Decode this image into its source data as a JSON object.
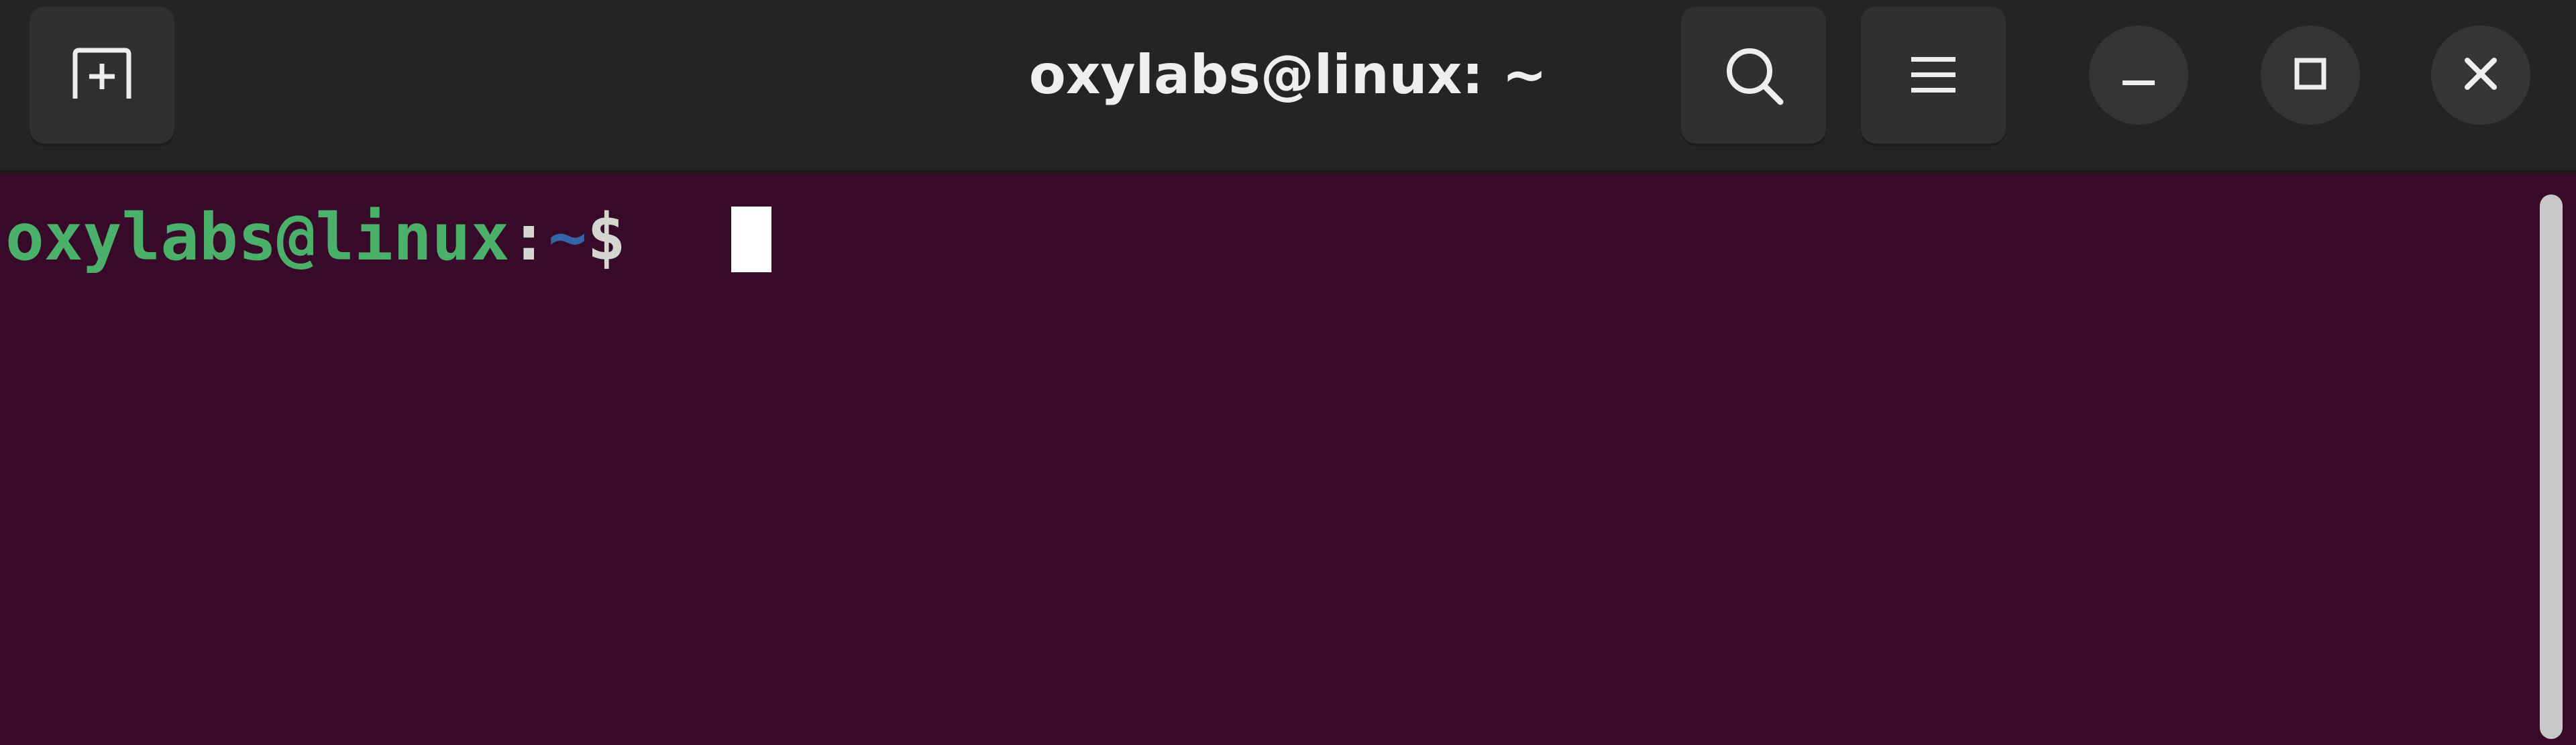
{
  "window": {
    "title": "oxylabs@linux: ~"
  },
  "header": {
    "new_tab_icon": "new-tab-icon",
    "search_icon": "search-icon",
    "menu_icon": "hamburger-menu-icon",
    "minimize_icon": "minimize-icon",
    "maximize_icon": "maximize-icon",
    "close_icon": "close-icon"
  },
  "terminal": {
    "prompt_user_host": "oxylabs@linux",
    "prompt_colon": ":",
    "prompt_path": "~",
    "prompt_symbol": "$",
    "input": ""
  },
  "colors": {
    "terminal_bg": "#370a2a",
    "headerbar_bg": "#242424",
    "prompt_user": "#4ab06a",
    "prompt_path": "#3465a4"
  }
}
